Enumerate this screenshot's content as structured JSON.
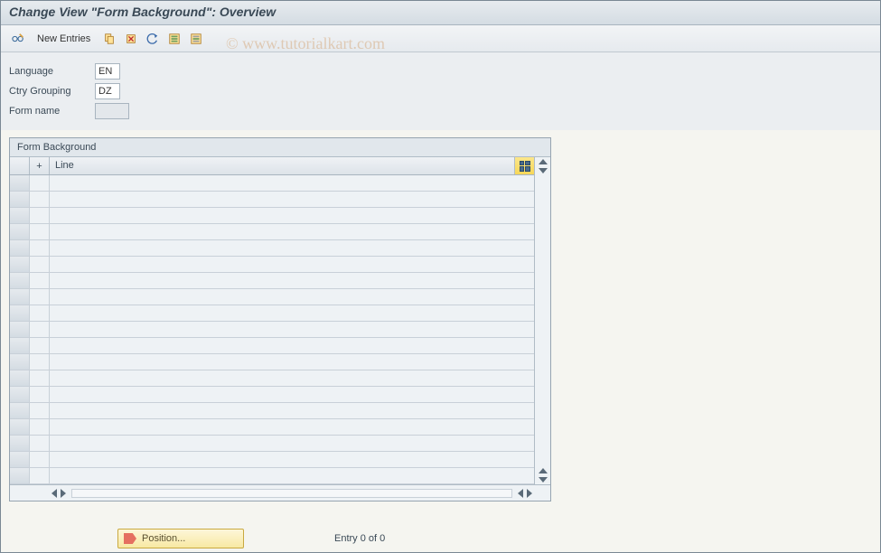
{
  "title": "Change View \"Form Background\": Overview",
  "watermark": "© www.tutorialkart.com",
  "toolbar": {
    "new_entries_label": "New Entries"
  },
  "form": {
    "language_label": "Language",
    "language_value": "EN",
    "ctry_label": "Ctry Grouping",
    "ctry_value": "DZ",
    "formname_label": "Form name",
    "formname_value": ""
  },
  "table": {
    "title": "Form Background",
    "col_plus": "+",
    "col_line": "Line",
    "rows": [
      "",
      "",
      "",
      "",
      "",
      "",
      "",
      "",
      "",
      "",
      "",
      "",
      "",
      "",
      "",
      "",
      "",
      "",
      ""
    ]
  },
  "footer": {
    "position_label": "Position...",
    "entry_text": "Entry 0 of 0"
  }
}
